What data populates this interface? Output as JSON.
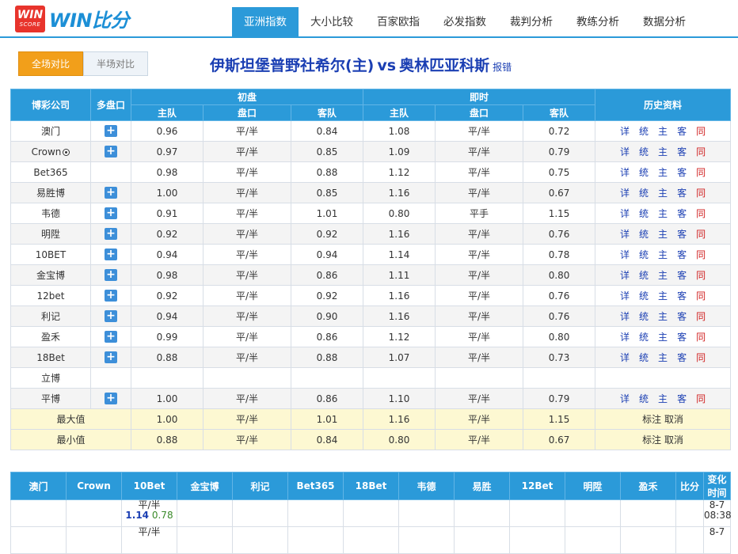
{
  "brand": {
    "badge_top": "WIN",
    "badge_bottom": "SCORE",
    "name": "WIN比分"
  },
  "nav": [
    {
      "label": "亚洲指数",
      "active": true
    },
    {
      "label": "大小比较"
    },
    {
      "label": "百家欧指"
    },
    {
      "label": "必发指数"
    },
    {
      "label": "裁判分析"
    },
    {
      "label": "教练分析"
    },
    {
      "label": "数据分析"
    }
  ],
  "toolbar": {
    "full_label": "全场对比",
    "half_label": "半场对比"
  },
  "match": {
    "home": "伊斯坦堡普野社希尔(主)",
    "vs": "vs",
    "away": "奥林匹亚科斯",
    "report": "报错"
  },
  "table_head": {
    "company": "博彩公司",
    "multi": "多盘口",
    "initial": "初盘",
    "live": "即时",
    "history": "历史资料",
    "home": "主队",
    "line": "盘口",
    "away": "客队"
  },
  "history_links": [
    "详",
    "统",
    "主",
    "客",
    "同"
  ],
  "rows": [
    {
      "company": "澳门",
      "plus": true,
      "i_home": "0.96",
      "i_line": "平/半",
      "i_away": "0.84",
      "l_home": "1.08",
      "l_line": "平/半",
      "l_away": "0.72",
      "hist": true
    },
    {
      "company": "Crown",
      "ball": true,
      "plus": true,
      "i_home": "0.97",
      "i_line": "平/半",
      "i_away": "0.85",
      "l_home": "1.09",
      "l_line": "平/半",
      "l_away": "0.79",
      "hist": true
    },
    {
      "company": "Bet365",
      "plus": false,
      "i_home": "0.98",
      "i_line": "平/半",
      "i_away": "0.88",
      "l_home": "1.12",
      "l_line": "平/半",
      "l_away": "0.75",
      "hist": true
    },
    {
      "company": "易胜博",
      "plus": true,
      "i_home": "1.00",
      "i_line": "平/半",
      "i_away": "0.85",
      "l_home": "1.16",
      "l_line": "平/半",
      "l_away": "0.67",
      "hist": true
    },
    {
      "company": "韦德",
      "plus": true,
      "i_home": "0.91",
      "i_line": "平/半",
      "i_away": "1.01",
      "l_home": "0.80",
      "l_line": "平手",
      "l_away": "1.15",
      "hist": true
    },
    {
      "company": "明陞",
      "plus": true,
      "i_home": "0.92",
      "i_line": "平/半",
      "i_away": "0.92",
      "l_home": "1.16",
      "l_line": "平/半",
      "l_away": "0.76",
      "hist": true
    },
    {
      "company": "10BET",
      "plus": true,
      "i_home": "0.94",
      "i_line": "平/半",
      "i_away": "0.94",
      "l_home": "1.14",
      "l_line": "平/半",
      "l_away": "0.78",
      "hist": true
    },
    {
      "company": "金宝博",
      "plus": true,
      "i_home": "0.98",
      "i_line": "平/半",
      "i_away": "0.86",
      "l_home": "1.11",
      "l_line": "平/半",
      "l_away": "0.80",
      "hist": true
    },
    {
      "company": "12bet",
      "plus": true,
      "i_home": "0.92",
      "i_line": "平/半",
      "i_away": "0.92",
      "l_home": "1.16",
      "l_line": "平/半",
      "l_away": "0.76",
      "hist": true
    },
    {
      "company": "利记",
      "plus": true,
      "i_home": "0.94",
      "i_line": "平/半",
      "i_away": "0.90",
      "l_home": "1.16",
      "l_line": "平/半",
      "l_away": "0.76",
      "hist": true
    },
    {
      "company": "盈禾",
      "plus": true,
      "i_home": "0.99",
      "i_line": "平/半",
      "i_away": "0.86",
      "l_home": "1.12",
      "l_line": "平/半",
      "l_away": "0.80",
      "hist": true
    },
    {
      "company": "18Bet",
      "plus": true,
      "i_home": "0.88",
      "i_line": "平/半",
      "i_away": "0.88",
      "l_home": "1.07",
      "l_line": "平/半",
      "l_away": "0.73",
      "hist": true
    },
    {
      "company": "立博",
      "plus": false,
      "i_home": "",
      "i_line": "",
      "i_away": "",
      "l_home": "",
      "l_line": "",
      "l_away": "",
      "hist": false
    },
    {
      "company": "平博",
      "plus": true,
      "i_home": "1.00",
      "i_line": "平/半",
      "i_away": "0.86",
      "l_home": "1.10",
      "l_line": "平/半",
      "l_away": "0.79",
      "hist": true
    }
  ],
  "summary": [
    {
      "label": "最大值",
      "i_home": "1.00",
      "i_line": "平/半",
      "i_away": "1.01",
      "l_home": "1.16",
      "l_line": "平/半",
      "l_away": "1.15",
      "actions": "标注 取消"
    },
    {
      "label": "最小值",
      "i_home": "0.88",
      "i_line": "平/半",
      "i_away": "0.84",
      "l_home": "0.80",
      "l_line": "平/半",
      "l_away": "0.67",
      "actions": "标注 取消"
    }
  ],
  "change_table": {
    "headers": [
      "澳门",
      "Crown",
      "10Bet",
      "金宝博",
      "利记",
      "Bet365",
      "18Bet",
      "韦德",
      "易胜",
      "12Bet",
      "明陞",
      "盈禾",
      "比分",
      "变化时间"
    ],
    "rows": [
      {
        "col10bet_line": "平/半",
        "col10bet_home": "1.14",
        "col10bet_away": "0.78",
        "time_date": "8-7",
        "time_clock": "08:38"
      },
      {
        "col10bet_line": "平/半",
        "col10bet_home": "",
        "col10bet_away": "",
        "time_date": "8-7",
        "time_clock": ""
      }
    ]
  },
  "colors": {
    "accent": "#2b9ad9",
    "orange": "#f29f1a",
    "brand_red": "#e8342c",
    "link_blue": "#1b3fb3",
    "link_red": "#d02020"
  }
}
